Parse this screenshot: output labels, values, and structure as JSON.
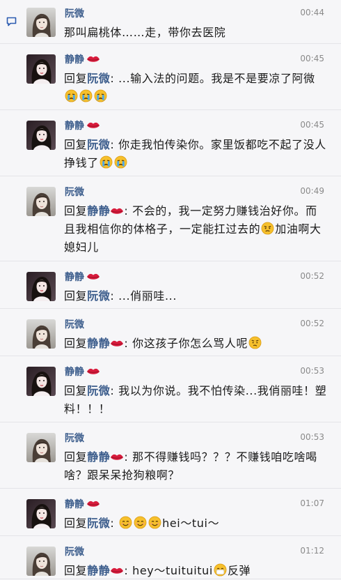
{
  "sidebar": {
    "icon": "chat-bubble-icon"
  },
  "messages": [
    {
      "author": "阮微",
      "lips": false,
      "avatar": "ruanwei",
      "time": "00:44",
      "reply": false,
      "mention": "",
      "mention_lips": false,
      "text": "那叫扁桃体……走，带你去医院",
      "emojis": []
    },
    {
      "author": "静静",
      "lips": true,
      "avatar": "jingjing",
      "time": "00:45",
      "reply": true,
      "mention": "阮微",
      "mention_lips": false,
      "text": "...输入法的问题。我是不是要凉了阿微",
      "emojis": [
        "crying",
        "crying",
        "crying"
      ]
    },
    {
      "author": "静静",
      "lips": true,
      "avatar": "jingjing",
      "time": "00:45",
      "reply": true,
      "mention": "阮微",
      "mention_lips": false,
      "text": "你走我怕传染你。家里饭都吃不起了没人挣钱了",
      "emojis": [
        "crying",
        "crying"
      ]
    },
    {
      "author": "阮微",
      "lips": false,
      "avatar": "ruanwei",
      "time": "00:49",
      "reply": true,
      "mention": "静静",
      "mention_lips": true,
      "text": "不会的，我一定努力赚钱治好你。而且我相信你的体格子，一定能扛过去的",
      "emojis": [
        "frowning"
      ],
      "text_after": "加油啊大媳妇儿"
    },
    {
      "author": "静静",
      "lips": true,
      "avatar": "jingjing",
      "time": "00:52",
      "reply": true,
      "mention": "阮微",
      "mention_lips": false,
      "text": "...俏丽哇...",
      "emojis": []
    },
    {
      "author": "阮微",
      "lips": false,
      "avatar": "ruanwei",
      "time": "00:52",
      "reply": true,
      "mention": "静静",
      "mention_lips": true,
      "text": "你这孩子你怎么骂人呢",
      "emojis": [
        "confused"
      ]
    },
    {
      "author": "静静",
      "lips": true,
      "avatar": "jingjing",
      "time": "00:53",
      "reply": true,
      "mention": "阮微",
      "mention_lips": false,
      "text": "我以为你说。我不怕传染...我俏丽哇！塑料！！！",
      "emojis": []
    },
    {
      "author": "阮微",
      "lips": false,
      "avatar": "ruanwei",
      "time": "00:53",
      "reply": true,
      "mention": "静静",
      "mention_lips": true,
      "text": "那不得赚钱吗？？？不赚钱咱吃啥喝啥？跟呆呆抢狗粮啊？",
      "emojis": []
    },
    {
      "author": "静静",
      "lips": true,
      "avatar": "jingjing",
      "time": "01:07",
      "reply": true,
      "mention": "阮微",
      "mention_lips": false,
      "text": "",
      "emojis": [
        "smile",
        "smile",
        "smile"
      ],
      "text_after": "hei～tui～"
    },
    {
      "author": "阮微",
      "lips": false,
      "avatar": "ruanwei",
      "time": "01:12",
      "reply": true,
      "mention": "静静",
      "mention_lips": true,
      "text": "hey～tuituitui",
      "emojis": [
        "mask"
      ],
      "text_after": "反弹"
    }
  ],
  "reply_word": "回复",
  "colors": {
    "name": "#3c5d8c",
    "lips": "#d81b3c",
    "emoji": "#f6c02c"
  }
}
